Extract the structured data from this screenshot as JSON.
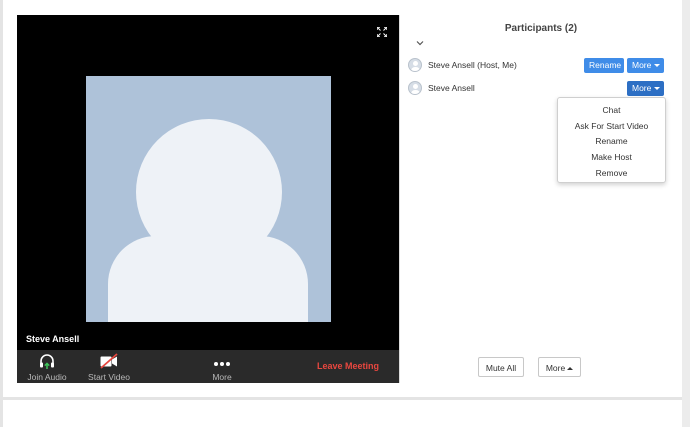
{
  "video": {
    "participant_name": "Steve Ansell",
    "toolbar": {
      "join_audio": "Join Audio",
      "start_video": "Start Video",
      "more": "More",
      "leave_meeting": "Leave Meeting"
    }
  },
  "participants": {
    "title": "Participants (2)",
    "list": [
      {
        "name": "Steve Ansell (Host, Me)",
        "rename_label": "Rename",
        "more_label": "More"
      },
      {
        "name": "Steve Ansell",
        "more_label": "More"
      }
    ],
    "menu": [
      "Chat",
      "Ask For Start Video",
      "Rename",
      "Make Host",
      "Remove"
    ],
    "footer": {
      "mute_all": "Mute All",
      "more": "More"
    }
  },
  "colors": {
    "accent_blue": "#3f8ce8",
    "leave_red": "#e8473f",
    "avatar_bg": "#aec2d9"
  }
}
